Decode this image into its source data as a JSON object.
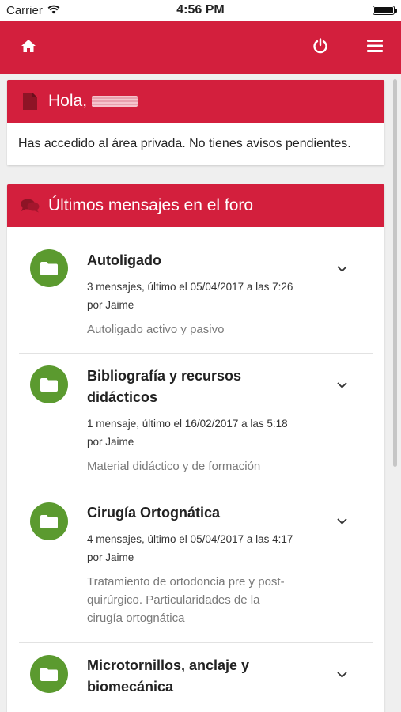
{
  "status_bar": {
    "carrier": "Carrier",
    "time": "4:56 PM"
  },
  "app_bar": {
    "icons": [
      "home-icon",
      "power-icon",
      "menu-icon"
    ],
    "color": "#d31f3d"
  },
  "greeting_card": {
    "title": "Hola,",
    "message": "Has accedido al área privada. No tienes avisos pendientes."
  },
  "forum_card": {
    "title": "Últimos mensajes en el foro",
    "items": [
      {
        "title_line1": "Autoligado",
        "title_line2": "",
        "meta_line1": "3 mensajes, último el 05/04/2017 a las 7:26",
        "meta_line2": "por Jaime",
        "desc_lines": [
          "Autoligado activo y pasivo"
        ]
      },
      {
        "title_line1": "Bibliografía y recursos",
        "title_line2": "didácticos",
        "meta_line1": "1 mensaje, último el 16/02/2017 a las 5:18",
        "meta_line2": "por Jaime",
        "desc_lines": [
          "Material didáctico y de formación"
        ]
      },
      {
        "title_line1": "Cirugía Ortognática",
        "title_line2": "",
        "meta_line1": "4 mensajes, último el 05/04/2017 a las 4:17",
        "meta_line2": "por Jaime",
        "desc_lines": [
          "Tratamiento de ortodoncia pre y post-",
          "quirúrgico. Particularidades de la",
          "cirugía ortognática"
        ]
      },
      {
        "title_line1": "Microtornillos, anclaje y",
        "title_line2": "biomecánica",
        "meta_line1": "",
        "meta_line2": "",
        "desc_lines": []
      }
    ]
  },
  "colors": {
    "primary": "#d31f3d",
    "folder_green": "#5b9a2f"
  }
}
